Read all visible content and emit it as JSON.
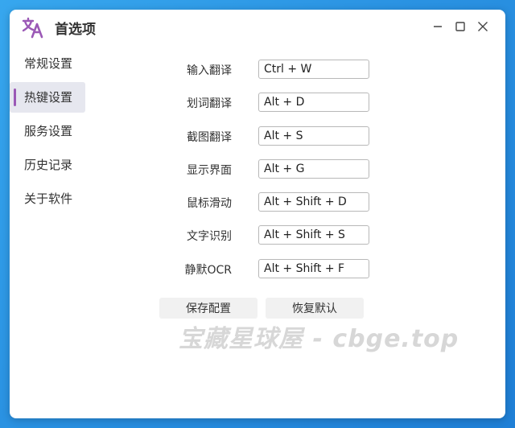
{
  "window": {
    "title": "首选项",
    "accent_color": "#9b59b6"
  },
  "titlebar": {
    "logo_icon": "translate-icon",
    "minimize_icon": "minimize-icon",
    "maximize_icon": "maximize-icon",
    "close_icon": "close-icon"
  },
  "sidebar": {
    "items": [
      {
        "label": "常规设置",
        "active": false
      },
      {
        "label": "热键设置",
        "active": true
      },
      {
        "label": "服务设置",
        "active": false
      },
      {
        "label": "历史记录",
        "active": false
      },
      {
        "label": "关于软件",
        "active": false
      }
    ]
  },
  "hotkeys": [
    {
      "label": "输入翻译",
      "value": "Ctrl + W"
    },
    {
      "label": "划词翻译",
      "value": "Alt + D"
    },
    {
      "label": "截图翻译",
      "value": "Alt + S"
    },
    {
      "label": "显示界面",
      "value": "Alt + G"
    },
    {
      "label": "鼠标滑动",
      "value": "Alt + Shift + D"
    },
    {
      "label": "文字识别",
      "value": "Alt + Shift + S"
    },
    {
      "label": "静默OCR",
      "value": "Alt + Shift + F"
    }
  ],
  "actions": {
    "save_label": "保存配置",
    "reset_label": "恢复默认"
  },
  "watermark": "宝藏星球屋 - cbge.top"
}
